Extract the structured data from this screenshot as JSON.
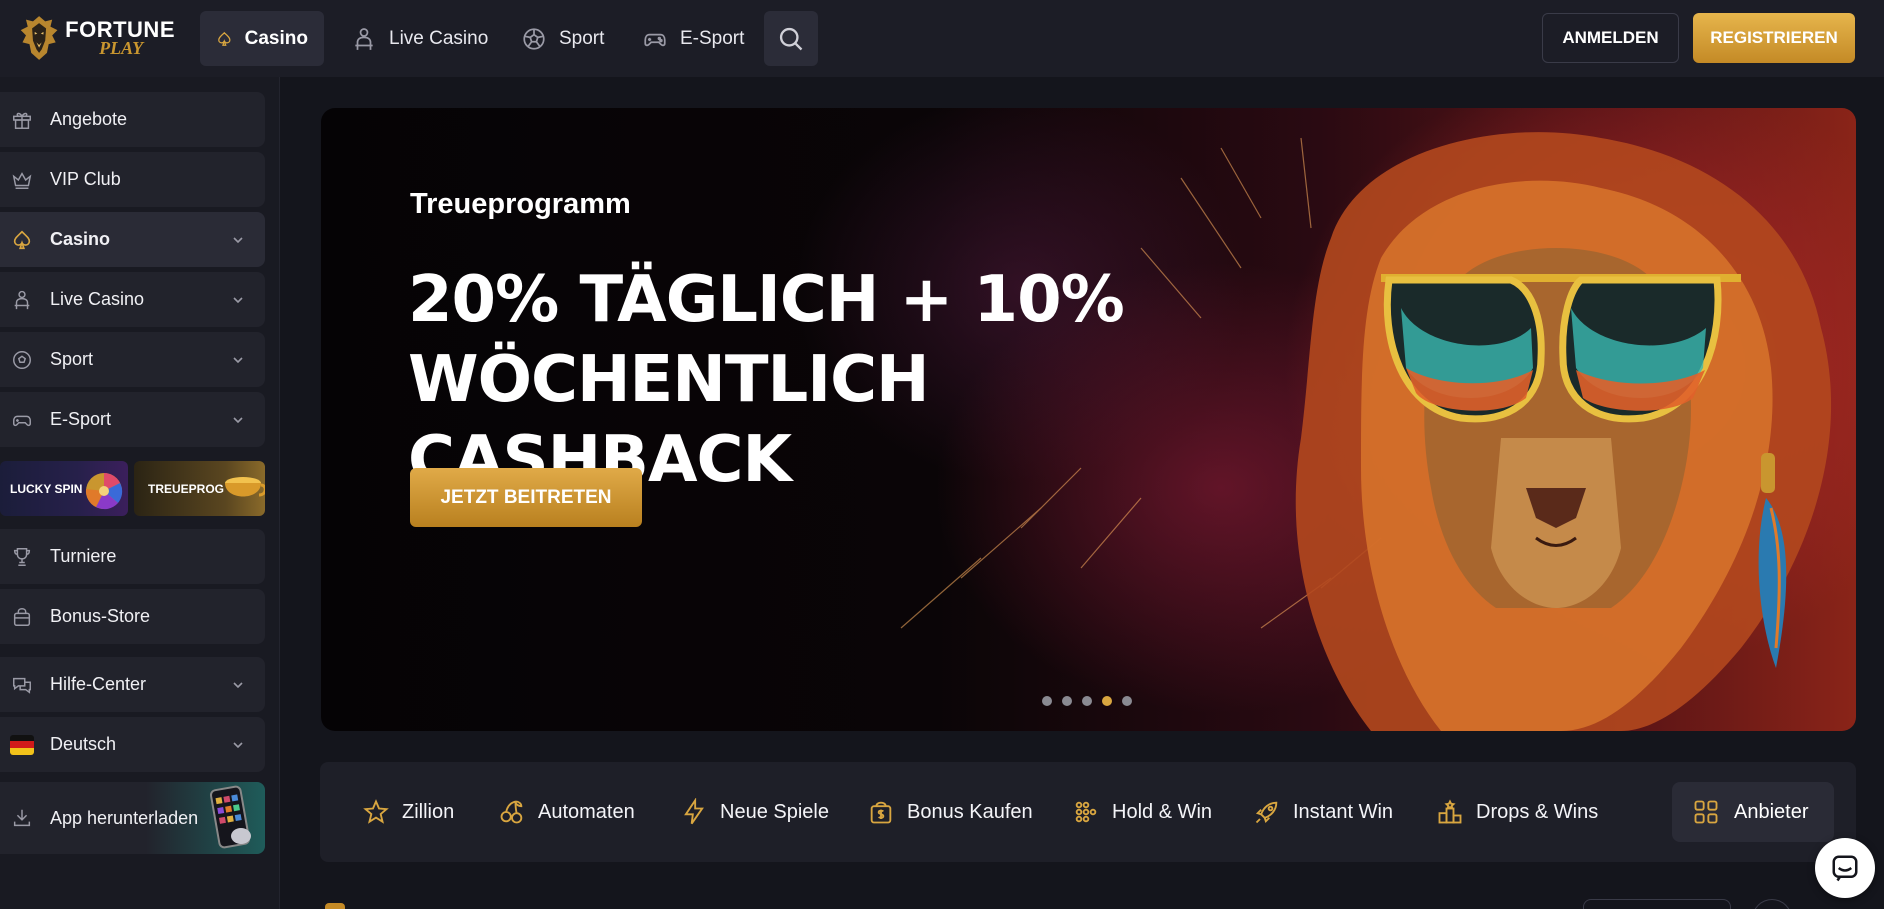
{
  "brand": {
    "name_line1": "FORTUNE",
    "name_line2": "PLAY"
  },
  "header": {
    "tabs": [
      {
        "label": "Casino",
        "icon": "spade-icon",
        "active": true
      },
      {
        "label": "Live Casino",
        "icon": "dealer-icon",
        "active": false
      },
      {
        "label": "Sport",
        "icon": "soccer-ball-icon",
        "active": false
      },
      {
        "label": "E-Sport",
        "icon": "gamepad-icon",
        "active": false
      }
    ],
    "login_label": "ANMELDEN",
    "register_label": "REGISTRIEREN"
  },
  "sidebar": {
    "items": [
      {
        "label": "Angebote",
        "icon": "gift-icon",
        "expandable": false
      },
      {
        "label": "VIP Club",
        "icon": "crown-icon",
        "expandable": false
      },
      {
        "label": "Casino",
        "icon": "spade-icon",
        "expandable": true,
        "active": true
      },
      {
        "label": "Live Casino",
        "icon": "dealer-icon",
        "expandable": true
      },
      {
        "label": "Sport",
        "icon": "soccer-ball-icon",
        "expandable": true
      },
      {
        "label": "E-Sport",
        "icon": "gamepad-icon",
        "expandable": true
      }
    ],
    "promos": {
      "lucky_spin": "LUCKY SPIN",
      "treueprogramm": "TREUEPROG"
    },
    "items2": [
      {
        "label": "Turniere",
        "icon": "trophy-icon"
      },
      {
        "label": "Bonus-Store",
        "icon": "bag-icon"
      }
    ],
    "help_label": "Hilfe-Center",
    "language_label": "Deutsch",
    "app_label": "App herunterladen"
  },
  "hero": {
    "subtitle": "Treueprogramm",
    "title_line1": "20% TÄGLICH + 10%",
    "title_line2": "WÖCHENTLICH CASHBACK",
    "cta": "JETZT BEITRETEN",
    "slide_count": 5,
    "active_slide": 4
  },
  "categories": [
    {
      "label": "Zillion",
      "icon": "star-icon"
    },
    {
      "label": "Automaten",
      "icon": "cherries-icon"
    },
    {
      "label": "Neue Spiele",
      "icon": "lightning-icon"
    },
    {
      "label": "Bonus Kaufen",
      "icon": "bonus-bag-icon"
    },
    {
      "label": "Hold & Win",
      "icon": "dots-grid-icon"
    },
    {
      "label": "Instant Win",
      "icon": "rocket-icon"
    },
    {
      "label": "Drops & Wins",
      "icon": "podium-icon"
    }
  ],
  "providers_label": "Anbieter",
  "colors": {
    "accent": "#d9a640",
    "background": "#14151c",
    "panel": "#1e1f28"
  }
}
